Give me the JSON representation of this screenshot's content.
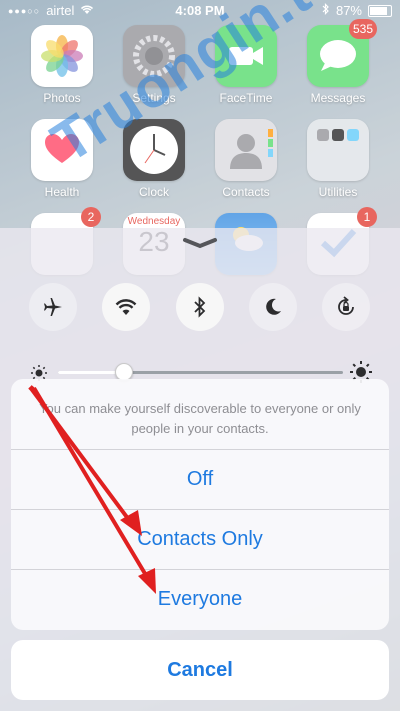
{
  "status_bar": {
    "signal": "●●●○○",
    "carrier": "airtel",
    "time": "4:08 PM",
    "battery": "87%",
    "battery_level": 0.87
  },
  "watermark": "Truongin.top",
  "home_apps": [
    {
      "name": "Photos"
    },
    {
      "name": "Settings"
    },
    {
      "name": "FaceTime"
    },
    {
      "name": "Messages",
      "badge": "535"
    },
    {
      "name": "Health"
    },
    {
      "name": "Clock"
    },
    {
      "name": "Contacts"
    },
    {
      "name": "Utilities"
    },
    {
      "badge": "2"
    },
    {
      "calendar_day": "Wednesday",
      "calendar_date": "23"
    },
    {},
    {
      "badge": "1"
    }
  ],
  "control_center": {
    "toggles": [
      {
        "name": "airplane-mode",
        "state": "off"
      },
      {
        "name": "wifi",
        "state": "on"
      },
      {
        "name": "bluetooth",
        "state": "on"
      },
      {
        "name": "do-not-disturb",
        "state": "off"
      },
      {
        "name": "rotation-lock",
        "state": "off"
      }
    ],
    "brightness": 0.23
  },
  "airdrop_sheet": {
    "message": "You can make yourself discoverable to everyone or only people in your contacts.",
    "options": [
      "Off",
      "Contacts Only",
      "Everyone"
    ],
    "cancel": "Cancel"
  },
  "colors": {
    "accent": "#1e7ae0",
    "badge": "#e0332a",
    "arrow": "#e02020"
  }
}
